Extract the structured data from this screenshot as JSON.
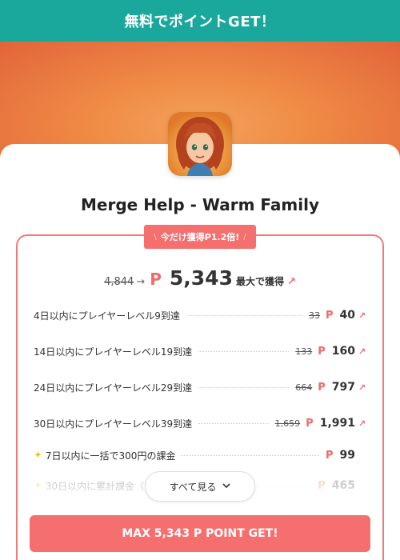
{
  "banner": {
    "title": "無料でポイントGET！"
  },
  "app": {
    "name": "Merge Help - Warm Family"
  },
  "badge": {
    "label": "今だけ獲得P1.2倍!"
  },
  "summary": {
    "old_value": "4,844",
    "currency": "P",
    "value": "5,343",
    "label": "最大で獲得"
  },
  "tasks": [
    {
      "label": "4日以内にプレイヤーレベル9到達",
      "old": "33",
      "points": "40",
      "boosted": true
    },
    {
      "label": "14日以内にプレイヤーレベル19到達",
      "old": "133",
      "points": "160",
      "boosted": true
    },
    {
      "label": "24日以内にプレイヤーレベル29到達",
      "old": "664",
      "points": "797",
      "boosted": true
    },
    {
      "label": "30日以内にプレイヤーレベル39到達",
      "old": "1,659",
      "points": "1,991",
      "boosted": true
    },
    {
      "label": "7日以内に一括で300円の課金",
      "points": "99",
      "star": true
    },
    {
      "label": "30日以内に累計課金（5",
      "points": "465",
      "star": true
    }
  ],
  "currency": "P",
  "see_all": {
    "label": "すべて見る"
  },
  "cta": {
    "label": "MAX 5,343 P POINT GET!"
  },
  "colors": {
    "banner": "#1aa79c",
    "accent": "#f56f6f"
  },
  "icons": {
    "up": "arrow-up-right-icon",
    "arrow": "arrow-right-icon",
    "star": "sparkle-icon",
    "chevron": "chevron-down-icon"
  }
}
